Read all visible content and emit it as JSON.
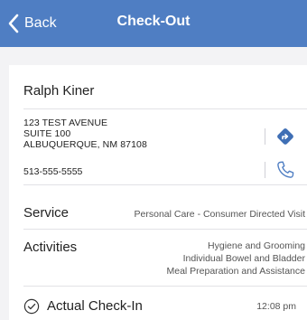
{
  "nav": {
    "back_label": "Back",
    "title": "Check-Out"
  },
  "client": {
    "name": "Ralph Kiner",
    "address_line1": "123 TEST AVENUE",
    "address_line2": "SUITE 100",
    "address_line3": "ALBUQUERQUE, NM 87108",
    "phone": "513-555-5555"
  },
  "service": {
    "label": "Service",
    "value": "Personal Care - Consumer Directed Visit"
  },
  "activities": {
    "label": "Activities",
    "items": [
      "Hygiene and Grooming",
      "Individual Bowel and Bladder",
      "Meal Preparation and Assistance"
    ]
  },
  "checkin": {
    "label": "Actual Check-In",
    "time": "12:08 pm"
  },
  "colors": {
    "nav_background": "#4f7ec3",
    "directions_icon": "#3f6fb5",
    "phone_icon": "#4f7ec3"
  },
  "icons": {
    "back": "chevron-left-icon",
    "directions": "directions-icon",
    "phone": "phone-icon",
    "checkin": "check-circle-icon"
  }
}
